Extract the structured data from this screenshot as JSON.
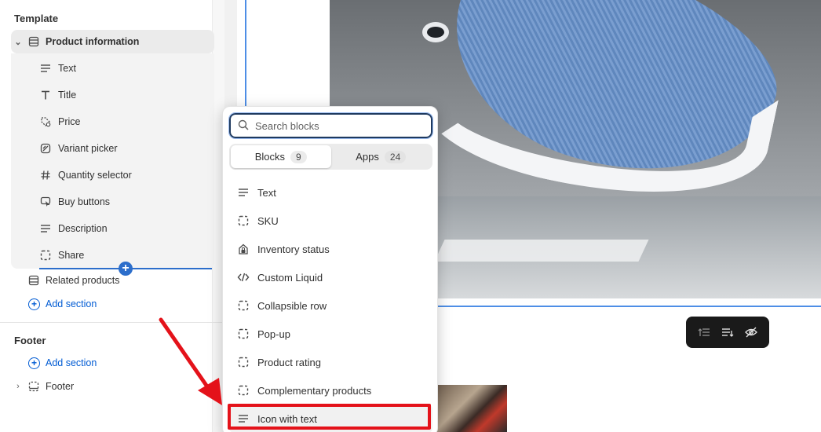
{
  "sidebar": {
    "template_title": "Template",
    "product_info_label": "Product information",
    "blocks": [
      {
        "label": "Text",
        "icon": "text-lines-icon"
      },
      {
        "label": "Title",
        "icon": "title-t-icon"
      },
      {
        "label": "Price",
        "icon": "price-tag-icon"
      },
      {
        "label": "Variant picker",
        "icon": "variant-picker-icon"
      },
      {
        "label": "Quantity selector",
        "icon": "hashtag-icon"
      },
      {
        "label": "Buy buttons",
        "icon": "cursor-click-icon"
      },
      {
        "label": "Description",
        "icon": "text-lines-icon"
      },
      {
        "label": "Share",
        "icon": "dashed-square-icon"
      }
    ],
    "related_products_label": "Related products",
    "add_section_label": "Add section",
    "footer_title": "Footer",
    "footer_add_section_label": "Add section",
    "footer_label": "Footer"
  },
  "popover": {
    "search_placeholder": "Search blocks",
    "tabs": [
      {
        "label": "Blocks",
        "count": "9",
        "active": true
      },
      {
        "label": "Apps",
        "count": "24",
        "active": false
      }
    ],
    "items": [
      {
        "label": "Text",
        "icon": "text-lines-icon"
      },
      {
        "label": "SKU",
        "icon": "dashed-square-icon"
      },
      {
        "label": "Inventory status",
        "icon": "inventory-lock-icon"
      },
      {
        "label": "Custom Liquid",
        "icon": "code-icon"
      },
      {
        "label": "Collapsible row",
        "icon": "dashed-square-icon"
      },
      {
        "label": "Pop-up",
        "icon": "dashed-square-icon"
      },
      {
        "label": "Product rating",
        "icon": "dashed-square-icon"
      },
      {
        "label": "Complementary products",
        "icon": "dashed-square-icon"
      },
      {
        "label": "Icon with text",
        "icon": "text-lines-icon"
      }
    ]
  },
  "colors": {
    "accent": "#005bd3",
    "selection_blue": "#2c6ecb",
    "annotation_red": "#e4121a"
  }
}
